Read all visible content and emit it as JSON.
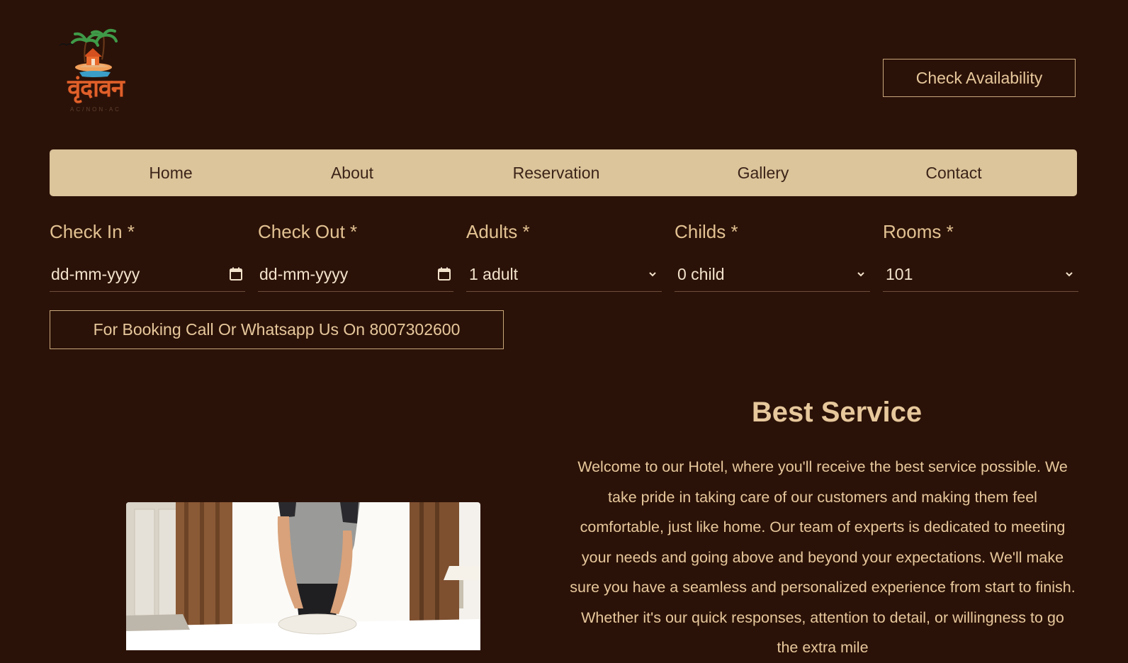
{
  "brand": {
    "logo_text": "वृंदावन",
    "logo_subtext": "AC/NON-AC"
  },
  "header": {
    "check_availability_label": "Check Availability"
  },
  "nav": {
    "items": [
      {
        "label": "Home"
      },
      {
        "label": "About"
      },
      {
        "label": "Reservation"
      },
      {
        "label": "Gallery"
      },
      {
        "label": "Contact"
      }
    ]
  },
  "booking_form": {
    "check_in": {
      "label": "Check In *",
      "placeholder": "dd-mm-yyyy",
      "icon": "calendar-icon"
    },
    "check_out": {
      "label": "Check Out *",
      "placeholder": "dd-mm-yyyy",
      "icon": "calendar-icon"
    },
    "adults": {
      "label": "Adults *",
      "value": "1 adult",
      "icon": "chevron-down-icon"
    },
    "childs": {
      "label": "Childs *",
      "value": "0 child",
      "icon": "chevron-down-icon"
    },
    "rooms": {
      "label": "Rooms *",
      "value": "101",
      "icon": "chevron-down-icon"
    }
  },
  "booking_note": "For Booking Call Or Whatsapp Us On 8007302600",
  "service": {
    "title": "Best Service",
    "body": "Welcome to our Hotel, where you'll receive the best service possible. We take pride in taking care of our customers and making them feel comfortable, just like home. Our team of experts is dedicated to meeting your needs and going above and beyond your expectations. We'll make sure you have a seamless and personalized experience from start to finish. Whether it's our quick responses, attention to detail, or willingness to go the extra mile"
  },
  "colors": {
    "background": "#2b1208",
    "accent_text": "#e7c89c",
    "nav_background": "#dcc49b",
    "nav_text": "#3b2418",
    "logo_orange": "#e0602a"
  }
}
